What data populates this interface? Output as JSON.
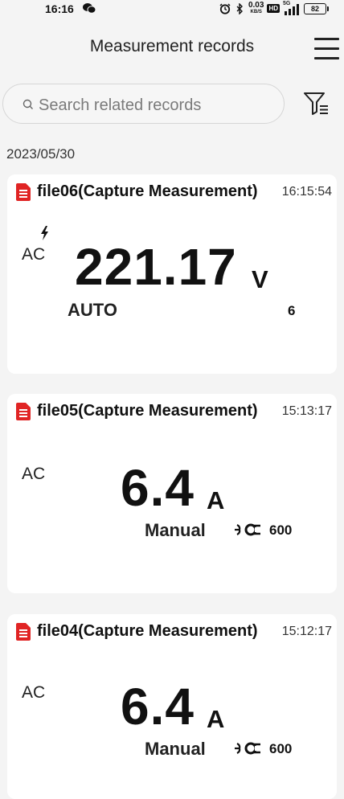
{
  "status_bar": {
    "time": "16:16",
    "net_speed_value": "0.03",
    "net_speed_unit": "KB/S",
    "hd_label": "HD",
    "signal_label": "5G",
    "battery": "82"
  },
  "header": {
    "title": "Measurement records"
  },
  "search": {
    "placeholder": "Search related records"
  },
  "date_label": "2023/05/30",
  "records": [
    {
      "title": "file06(Capture Measurement)",
      "time": "16:15:54",
      "mode": "AC",
      "value": "221.17",
      "unit": "V",
      "range": "AUTO",
      "range_num": "6"
    },
    {
      "title": "file05(Capture Measurement)",
      "time": "15:13:17",
      "mode": "AC",
      "value": "6.4",
      "unit": "A",
      "range": "Manual",
      "range_num": "600"
    },
    {
      "title": "file04(Capture Measurement)",
      "time": "15:12:17",
      "mode": "AC",
      "value": "6.4",
      "unit": "A",
      "range": "Manual",
      "range_num": "600"
    }
  ],
  "colors": {
    "accent": "#e02424",
    "background": "#f4f4f4",
    "card": "#ffffff"
  },
  "icons": [
    "wechat-icon",
    "alarm-icon",
    "bluetooth-icon",
    "signal-icon",
    "menu-icon",
    "search-icon",
    "filter-icon",
    "file-icon",
    "lightning-icon",
    "clamp-icon"
  ]
}
